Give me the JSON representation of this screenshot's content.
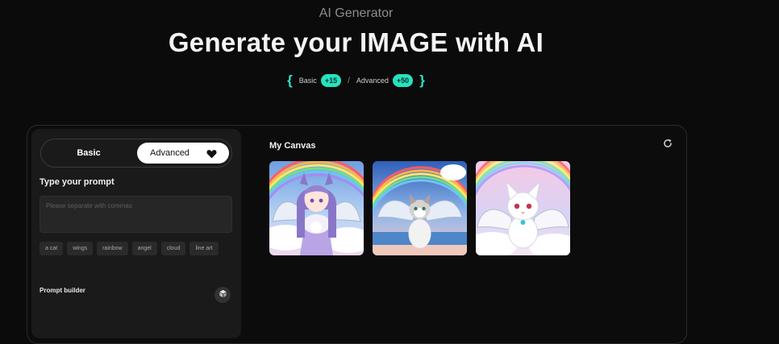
{
  "header": {
    "subtitle": "AI Generator",
    "title": "Generate your IMAGE with AI"
  },
  "credits": {
    "open_brace": "{",
    "close_brace": "}",
    "basic_label": "Basic",
    "basic_value": "+15",
    "separator": "/",
    "advanced_label": "Advanced",
    "advanced_value": "+50"
  },
  "panel": {
    "mode_basic": "Basic",
    "mode_advanced": "Advanced",
    "prompt_title": "Type your prompt",
    "prompt_placeholder": "Please separate with commas",
    "prompt_value": "",
    "chips": [
      "a cat",
      "wings",
      "rainbow",
      "angel",
      "cloud",
      "line art"
    ],
    "builder_label": "Prompt builder"
  },
  "canvas": {
    "title": "My Canvas"
  },
  "colors": {
    "accent": "#25e3c0",
    "background": "#0b0b0b",
    "panel": "#1a1a1a"
  },
  "icons": [
    "heart-icon",
    "cube-icon",
    "refresh-icon"
  ]
}
